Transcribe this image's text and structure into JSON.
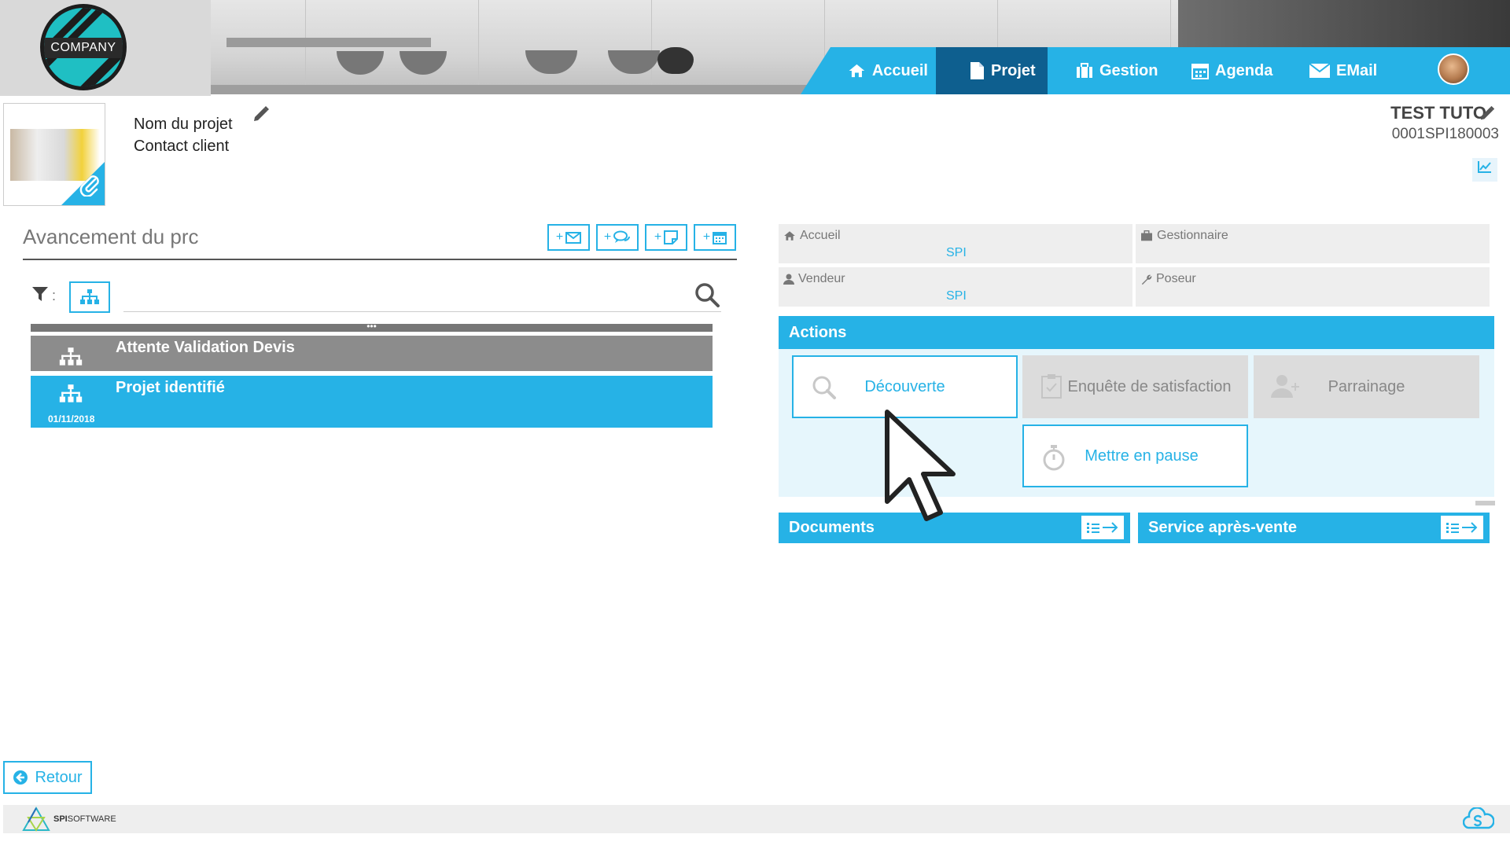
{
  "logo": {
    "text": "COMPANY"
  },
  "nav": {
    "items": [
      {
        "label": "Accueil",
        "icon": "home-icon"
      },
      {
        "label": "Projet",
        "icon": "file-icon",
        "active": true
      },
      {
        "label": "Gestion",
        "icon": "briefcase-icon"
      },
      {
        "label": "Agenda",
        "icon": "calendar-icon"
      },
      {
        "label": "EMail",
        "icon": "envelope-icon"
      }
    ],
    "accent": "#26b2e6",
    "active_color": "#0e5f8f"
  },
  "project": {
    "name_label": "Nom du projet",
    "contact_label": "Contact client",
    "client_name": "TEST TUTO",
    "client_code": "0001SPI180003"
  },
  "progress": {
    "title": "Avancement du prc",
    "quick_actions": [
      "+",
      "+",
      "+",
      "+"
    ],
    "filter_colon": ":",
    "collapse_label": "•••",
    "stages": [
      {
        "title": "Attente Validation Devis",
        "date": "",
        "state": "pending",
        "color": "#8c8c8c"
      },
      {
        "title": "Projet identifié",
        "date": "01/11/2018",
        "state": "current",
        "color": "#26b2e6"
      }
    ]
  },
  "info": {
    "accueil": {
      "label": "Accueil",
      "value": "SPI"
    },
    "gestionnaire": {
      "label": "Gestionnaire",
      "value": ""
    },
    "vendeur": {
      "label": "Vendeur",
      "value": "SPI"
    },
    "poseur": {
      "label": "Poseur",
      "value": ""
    }
  },
  "actions": {
    "title": "Actions",
    "buttons": [
      {
        "label": "Découverte",
        "enabled": true
      },
      {
        "label": "Enquête de satisfaction",
        "enabled": false
      },
      {
        "label": "Parrainage",
        "enabled": false
      },
      {
        "label": "Mettre en pause",
        "enabled": true
      }
    ]
  },
  "documents": {
    "title": "Documents"
  },
  "sav": {
    "title": "Service après-vente"
  },
  "footer": {
    "back_label": "Retour",
    "brand_bold": "SPI",
    "brand_rest": "SOFTWARE"
  }
}
